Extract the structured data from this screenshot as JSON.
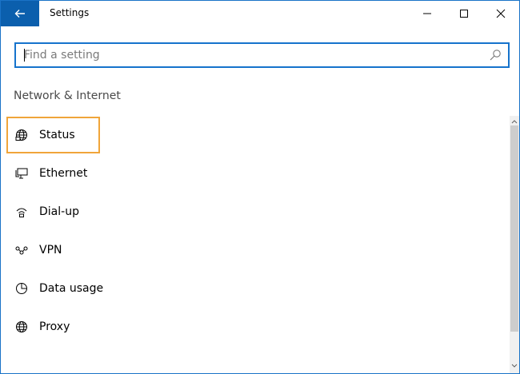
{
  "window": {
    "title": "Settings",
    "accent": "#0b5fad"
  },
  "search": {
    "placeholder": "Find a setting"
  },
  "section": {
    "title": "Network & Internet"
  },
  "nav_items": [
    {
      "label": "Status",
      "icon": "globe-icon",
      "focused": true
    },
    {
      "label": "Ethernet",
      "icon": "ethernet-icon"
    },
    {
      "label": "Dial-up",
      "icon": "dialup-icon"
    },
    {
      "label": "VPN",
      "icon": "vpn-icon"
    },
    {
      "label": "Data usage",
      "icon": "data-usage-icon"
    },
    {
      "label": "Proxy",
      "icon": "globe-icon"
    }
  ],
  "colors": {
    "focus": "#f0a53a",
    "search_border": "#1673cc",
    "section_text": "#4a4a4a"
  }
}
